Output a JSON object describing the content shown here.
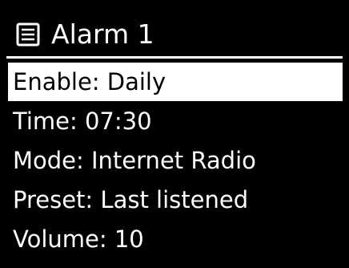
{
  "header": {
    "title": "Alarm 1",
    "icon": "menu-list-icon"
  },
  "menu": {
    "items": [
      {
        "label": "Enable: Daily",
        "selected": true
      },
      {
        "label": "Time: 07:30",
        "selected": false
      },
      {
        "label": "Mode: Internet Radio",
        "selected": false
      },
      {
        "label": "Preset: Last listened",
        "selected": false
      },
      {
        "label": "Volume: 10",
        "selected": false
      }
    ]
  },
  "colors": {
    "background": "#000000",
    "foreground": "#ffffff",
    "highlight": "#ffffff",
    "highlight_text": "#000000"
  }
}
